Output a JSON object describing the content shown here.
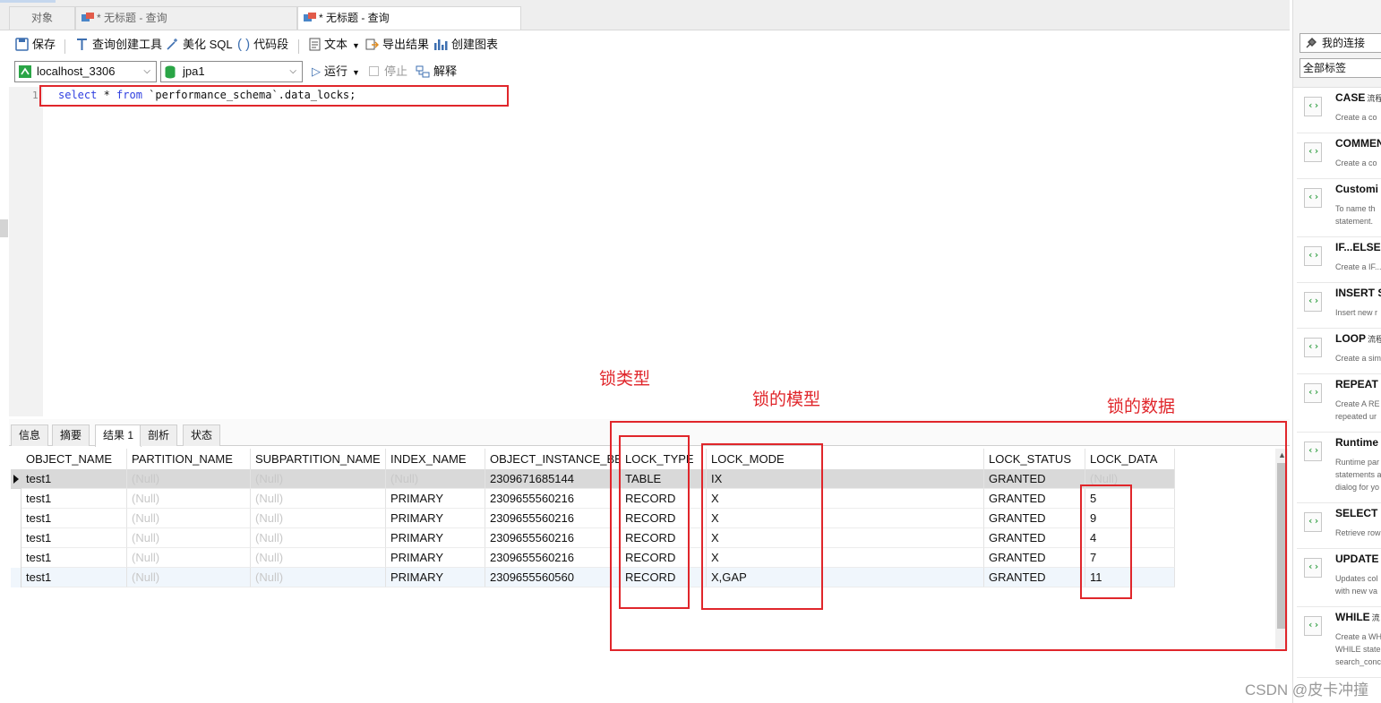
{
  "tabs": {
    "objects": "对象",
    "tab1": "* 无标题 - 查询",
    "tab2": "* 无标题 - 查询"
  },
  "toolbar": {
    "save": "保存",
    "query_builder": "查询创建工具",
    "beautify": "美化 SQL",
    "code_snippet": "代码段",
    "text": "文本",
    "export": "导出结果",
    "create_chart": "创建图表"
  },
  "connection": {
    "server": "localhost_3306",
    "database": "jpa1",
    "run": "运行",
    "stop": "停止",
    "explain": "解释"
  },
  "editor": {
    "line_number": "1",
    "kw_select": "select",
    "star": " * ",
    "kw_from": "from",
    "rest": " `performance_schema`.data_locks;"
  },
  "result_tabs": [
    "信息",
    "摘要",
    "结果 1",
    "剖析",
    "状态"
  ],
  "grid": {
    "columns": [
      "OBJECT_NAME",
      "PARTITION_NAME",
      "SUBPARTITION_NAME",
      "INDEX_NAME",
      "OBJECT_INSTANCE_BEG",
      "LOCK_TYPE",
      "LOCK_MODE",
      "LOCK_STATUS",
      "LOCK_DATA"
    ],
    "rows": [
      [
        "test1",
        "(Null)",
        "(Null)",
        "(Null)",
        "2309671685144",
        "TABLE",
        "IX",
        "GRANTED",
        "(Null)"
      ],
      [
        "test1",
        "(Null)",
        "(Null)",
        "PRIMARY",
        "2309655560216",
        "RECORD",
        "X",
        "GRANTED",
        "5"
      ],
      [
        "test1",
        "(Null)",
        "(Null)",
        "PRIMARY",
        "2309655560216",
        "RECORD",
        "X",
        "GRANTED",
        "9"
      ],
      [
        "test1",
        "(Null)",
        "(Null)",
        "PRIMARY",
        "2309655560216",
        "RECORD",
        "X",
        "GRANTED",
        "4"
      ],
      [
        "test1",
        "(Null)",
        "(Null)",
        "PRIMARY",
        "2309655560216",
        "RECORD",
        "X",
        "GRANTED",
        "7"
      ],
      [
        "test1",
        "(Null)",
        "(Null)",
        "PRIMARY",
        "2309655560560",
        "RECORD",
        "X,GAP",
        "GRANTED",
        "11"
      ]
    ]
  },
  "annotations": {
    "lock_type": "锁类型",
    "lock_mode": "锁的模型",
    "lock_data": "锁的数据"
  },
  "right_panel": {
    "my_connections": "我的连接",
    "all_tags": "全部标签",
    "snippets": [
      {
        "title": "CASE",
        "tag": "流程",
        "desc": [
          "Create a co"
        ]
      },
      {
        "title": "COMMEN",
        "tag": "",
        "desc": [
          "Create a co"
        ]
      },
      {
        "title": "Customi",
        "tag": "",
        "desc": [
          "To name th",
          "statement."
        ]
      },
      {
        "title": "IF...ELSE.",
        "tag": "",
        "desc": [
          "Create a IF..."
        ]
      },
      {
        "title": "INSERT S",
        "tag": "",
        "desc": [
          "Insert new r"
        ]
      },
      {
        "title": "LOOP",
        "tag": "流程",
        "desc": [
          "Create a sim"
        ]
      },
      {
        "title": "REPEAT",
        "tag": "",
        "desc": [
          "Create A RE",
          "repeated ur"
        ]
      },
      {
        "title": "Runtime",
        "tag": "",
        "desc": [
          "Runtime par",
          "statements a",
          "dialog for yo"
        ]
      },
      {
        "title": "SELECT S",
        "tag": "",
        "desc": [
          "Retrieve row"
        ]
      },
      {
        "title": "UPDATE",
        "tag": "",
        "desc": [
          "Updates col",
          "with new va"
        ]
      },
      {
        "title": "WHILE",
        "tag": "流",
        "desc": [
          "Create a WH",
          "WHILE state",
          "search_conc"
        ]
      }
    ]
  },
  "watermark": "CSDN @皮卡冲撞",
  "colors": {
    "annotation": "#e0262b",
    "keyword": "#2f3fe0",
    "null_text": "#c8c8c8"
  }
}
